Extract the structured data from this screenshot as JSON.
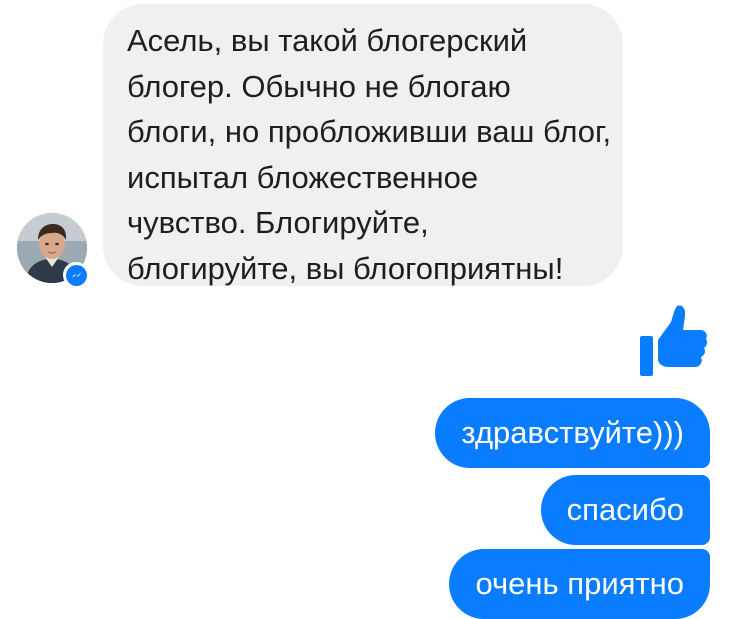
{
  "incoming": {
    "lines": [
      "Асель, вы такой блогерский",
      "блогер. Обычно не блогаю",
      "блоги, но пробложивши ваш блог,",
      "испытал бложественное",
      "чувство. Блогируйте,",
      "блогируйте, вы блогоприятны!"
    ]
  },
  "reaction": {
    "icon": "thumbs-up-icon",
    "color": "#0a7cff"
  },
  "outgoing": [
    "здравствуйте)))",
    "спасибо",
    "очень приятно"
  ],
  "colors": {
    "incoming_bubble": "#f1f0f0",
    "outgoing_bubble": "#0a7cff",
    "badge": "#0a7cff"
  }
}
